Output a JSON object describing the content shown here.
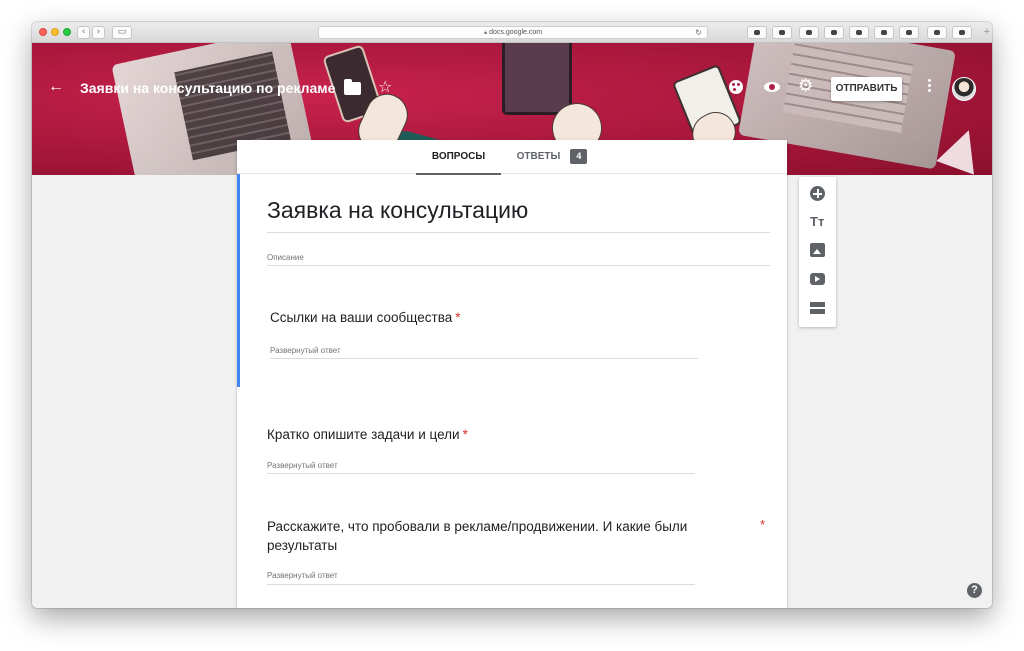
{
  "browser": {
    "url": "docs.google.com"
  },
  "header": {
    "title": "Заявки на консультацию по рекламе",
    "send_button": "ОТПРАВИТЬ"
  },
  "tabs": {
    "questions": "ВОПРОСЫ",
    "answers": "ОТВЕТЫ",
    "answers_count": "4"
  },
  "form": {
    "title": "Заявка на консультацию",
    "description_placeholder": "Описание",
    "questions": [
      {
        "title": "Ссылки на ваши сообщества",
        "required_mark": "*",
        "hint": "Развернутый ответ"
      },
      {
        "title": "Кратко опишите задачи и цели",
        "required_mark": "*",
        "hint": "Развернутый ответ"
      },
      {
        "title": "Расскажите, что пробовали в рекламе/продвижении. И какие были результаты",
        "required_mark": "*",
        "hint": "Развернутый ответ"
      }
    ]
  },
  "sidebar": {
    "add_title_glyph": "Tт"
  },
  "help": {
    "glyph": "?"
  },
  "colors": {
    "banner": "#b01d45",
    "accent": "#4285f4",
    "required": "#d93025"
  },
  "icons": [
    "back-arrow-icon",
    "folder-icon",
    "star-icon",
    "palette-icon",
    "preview-icon",
    "settings-icon",
    "more-icon",
    "add-question-icon",
    "add-title-icon",
    "add-image-icon",
    "add-video-icon",
    "add-section-icon",
    "help-icon"
  ]
}
